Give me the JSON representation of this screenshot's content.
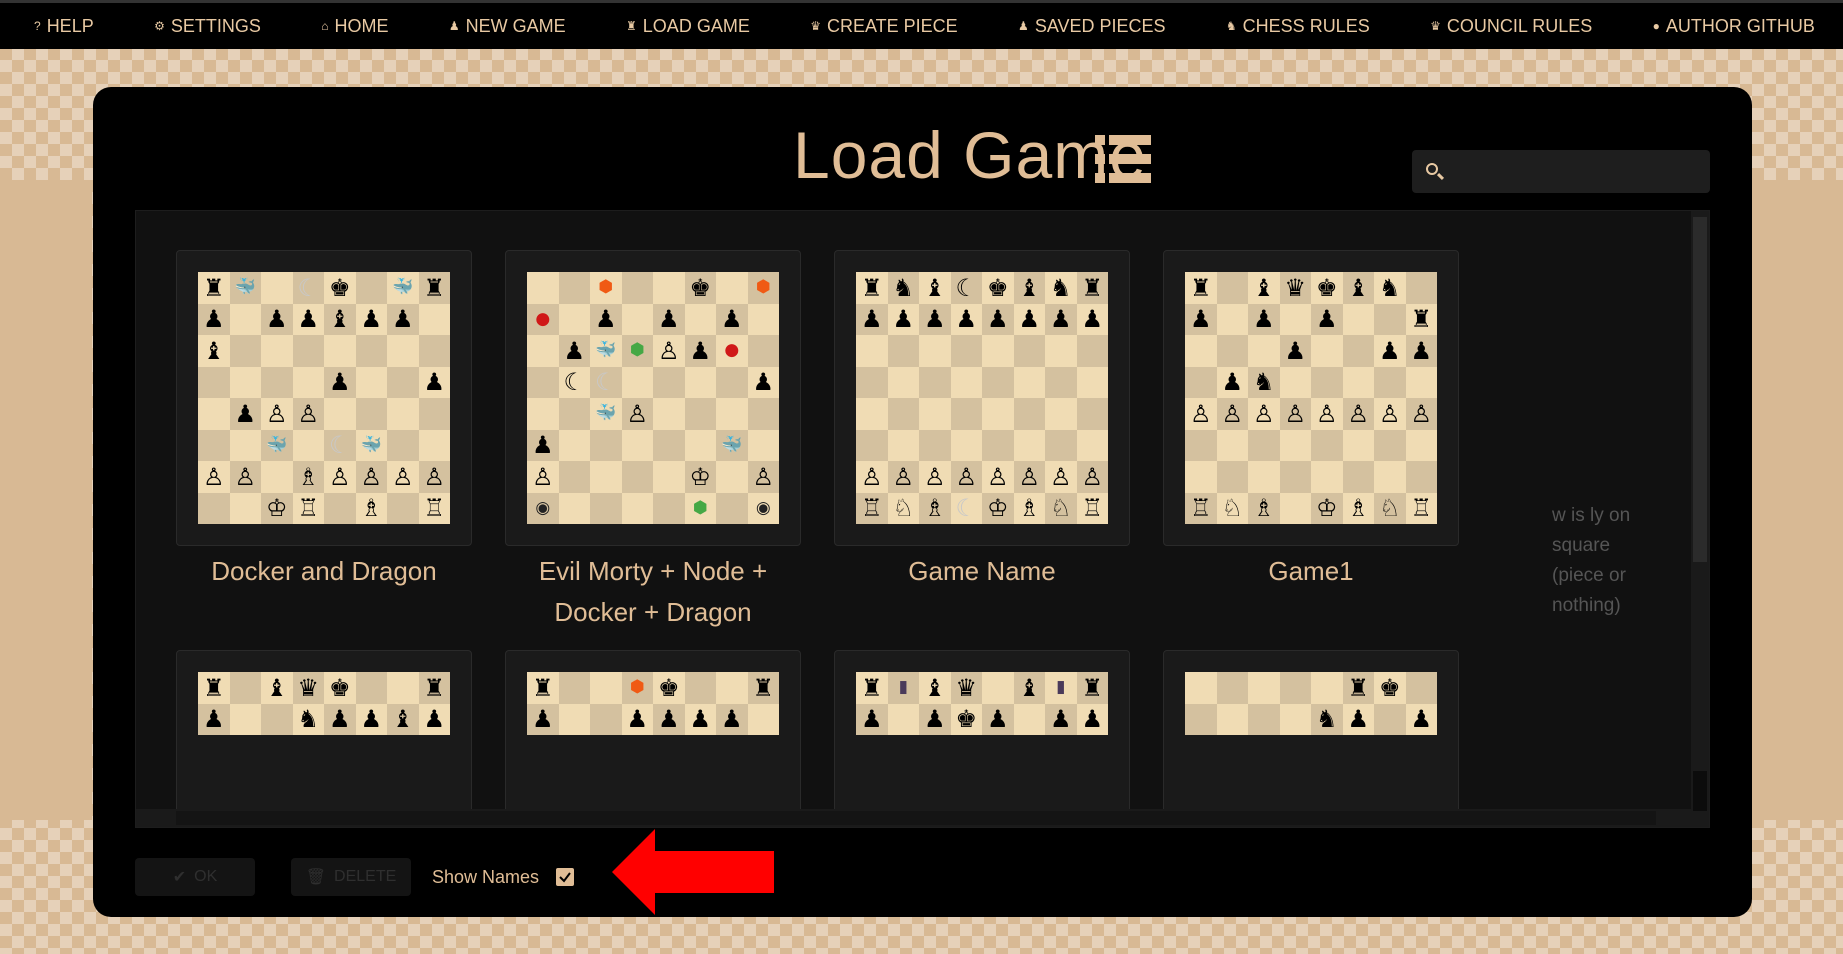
{
  "nav": [
    {
      "id": "help",
      "label": "HELP",
      "icon": "help-circle-icon",
      "glyph": "?"
    },
    {
      "id": "settings",
      "label": "SETTINGS",
      "icon": "gear-icon",
      "glyph": "⚙"
    },
    {
      "id": "home",
      "label": "HOME",
      "icon": "home-icon",
      "glyph": "⌂"
    },
    {
      "id": "new-game",
      "label": "NEW GAME",
      "icon": "pawn-icon",
      "glyph": "♟"
    },
    {
      "id": "load-game",
      "label": "LOAD GAME",
      "icon": "rook-icon",
      "glyph": "♜"
    },
    {
      "id": "create-piece",
      "label": "CREATE PIECE",
      "icon": "queen-icon",
      "glyph": "♛"
    },
    {
      "id": "saved-pieces",
      "label": "SAVED PIECES",
      "icon": "pawn-icon",
      "glyph": "♟"
    },
    {
      "id": "chess-rules",
      "label": "CHESS RULES",
      "icon": "knight-icon",
      "glyph": "♞"
    },
    {
      "id": "council-rules",
      "label": "COUNCIL RULES",
      "icon": "crown-icon",
      "glyph": "♛"
    },
    {
      "id": "author-github",
      "label": "AUTHOR GITHUB",
      "icon": "github-icon",
      "glyph": "●"
    }
  ],
  "modal": {
    "title": "Load Game",
    "search_placeholder": "",
    "alt_text": "w is ly on square (piece or nothing)"
  },
  "games": [
    {
      "name": "Docker and Dragon",
      "board": [
        "rC.Dk.Cr",
        "p.ppbpp.",
        "b.......",
        "....p..p",
        ".pPP....",
        "..W.DW..",
        "PP.BPPPP",
        "..KR.B.R"
      ]
    },
    {
      "name": "Evil Morty + Node + Docker + Dragon",
      "board": [
        "..o..k.o",
        "E.p.p.p.",
        ".pCgPpE.",
        ".dD....p",
        "..WP....",
        "p.....W.",
        "P....K.P",
        "e....g.e"
      ]
    },
    {
      "name": "Game Name",
      "board": [
        "rnbdkbnr",
        "pppppppp",
        "........",
        "........",
        "........",
        "........",
        "PPPPPPPP",
        "RNBDKBNR"
      ]
    },
    {
      "name": "Game1",
      "board": [
        "r.bqkbn.",
        "p.p.p..r",
        "...p..pp",
        ".pn.....",
        "PPPPPPPP",
        "........",
        "........",
        "RNB.KBNR"
      ]
    },
    {
      "name": "",
      "board": [
        "r.bqk..r",
        "p..nppbp"
      ]
    },
    {
      "name": "",
      "board": [
        "r..ok..r",
        "p..pppp."
      ]
    },
    {
      "name": "",
      "board": [
        "rmbq.bmr",
        "p.pkp.pp"
      ]
    },
    {
      "name": "",
      "board": [
        ".....rk.",
        "....np.p"
      ]
    }
  ],
  "footer": {
    "ok_label": "OK",
    "delete_label": "DELETE",
    "show_names_label": "Show Names",
    "show_names_checked": true
  },
  "colors": {
    "accent": "#e0bd96",
    "light_square": "#f0dcb4",
    "dark_square": "#d4c19f",
    "arrow": "#ff0000"
  }
}
